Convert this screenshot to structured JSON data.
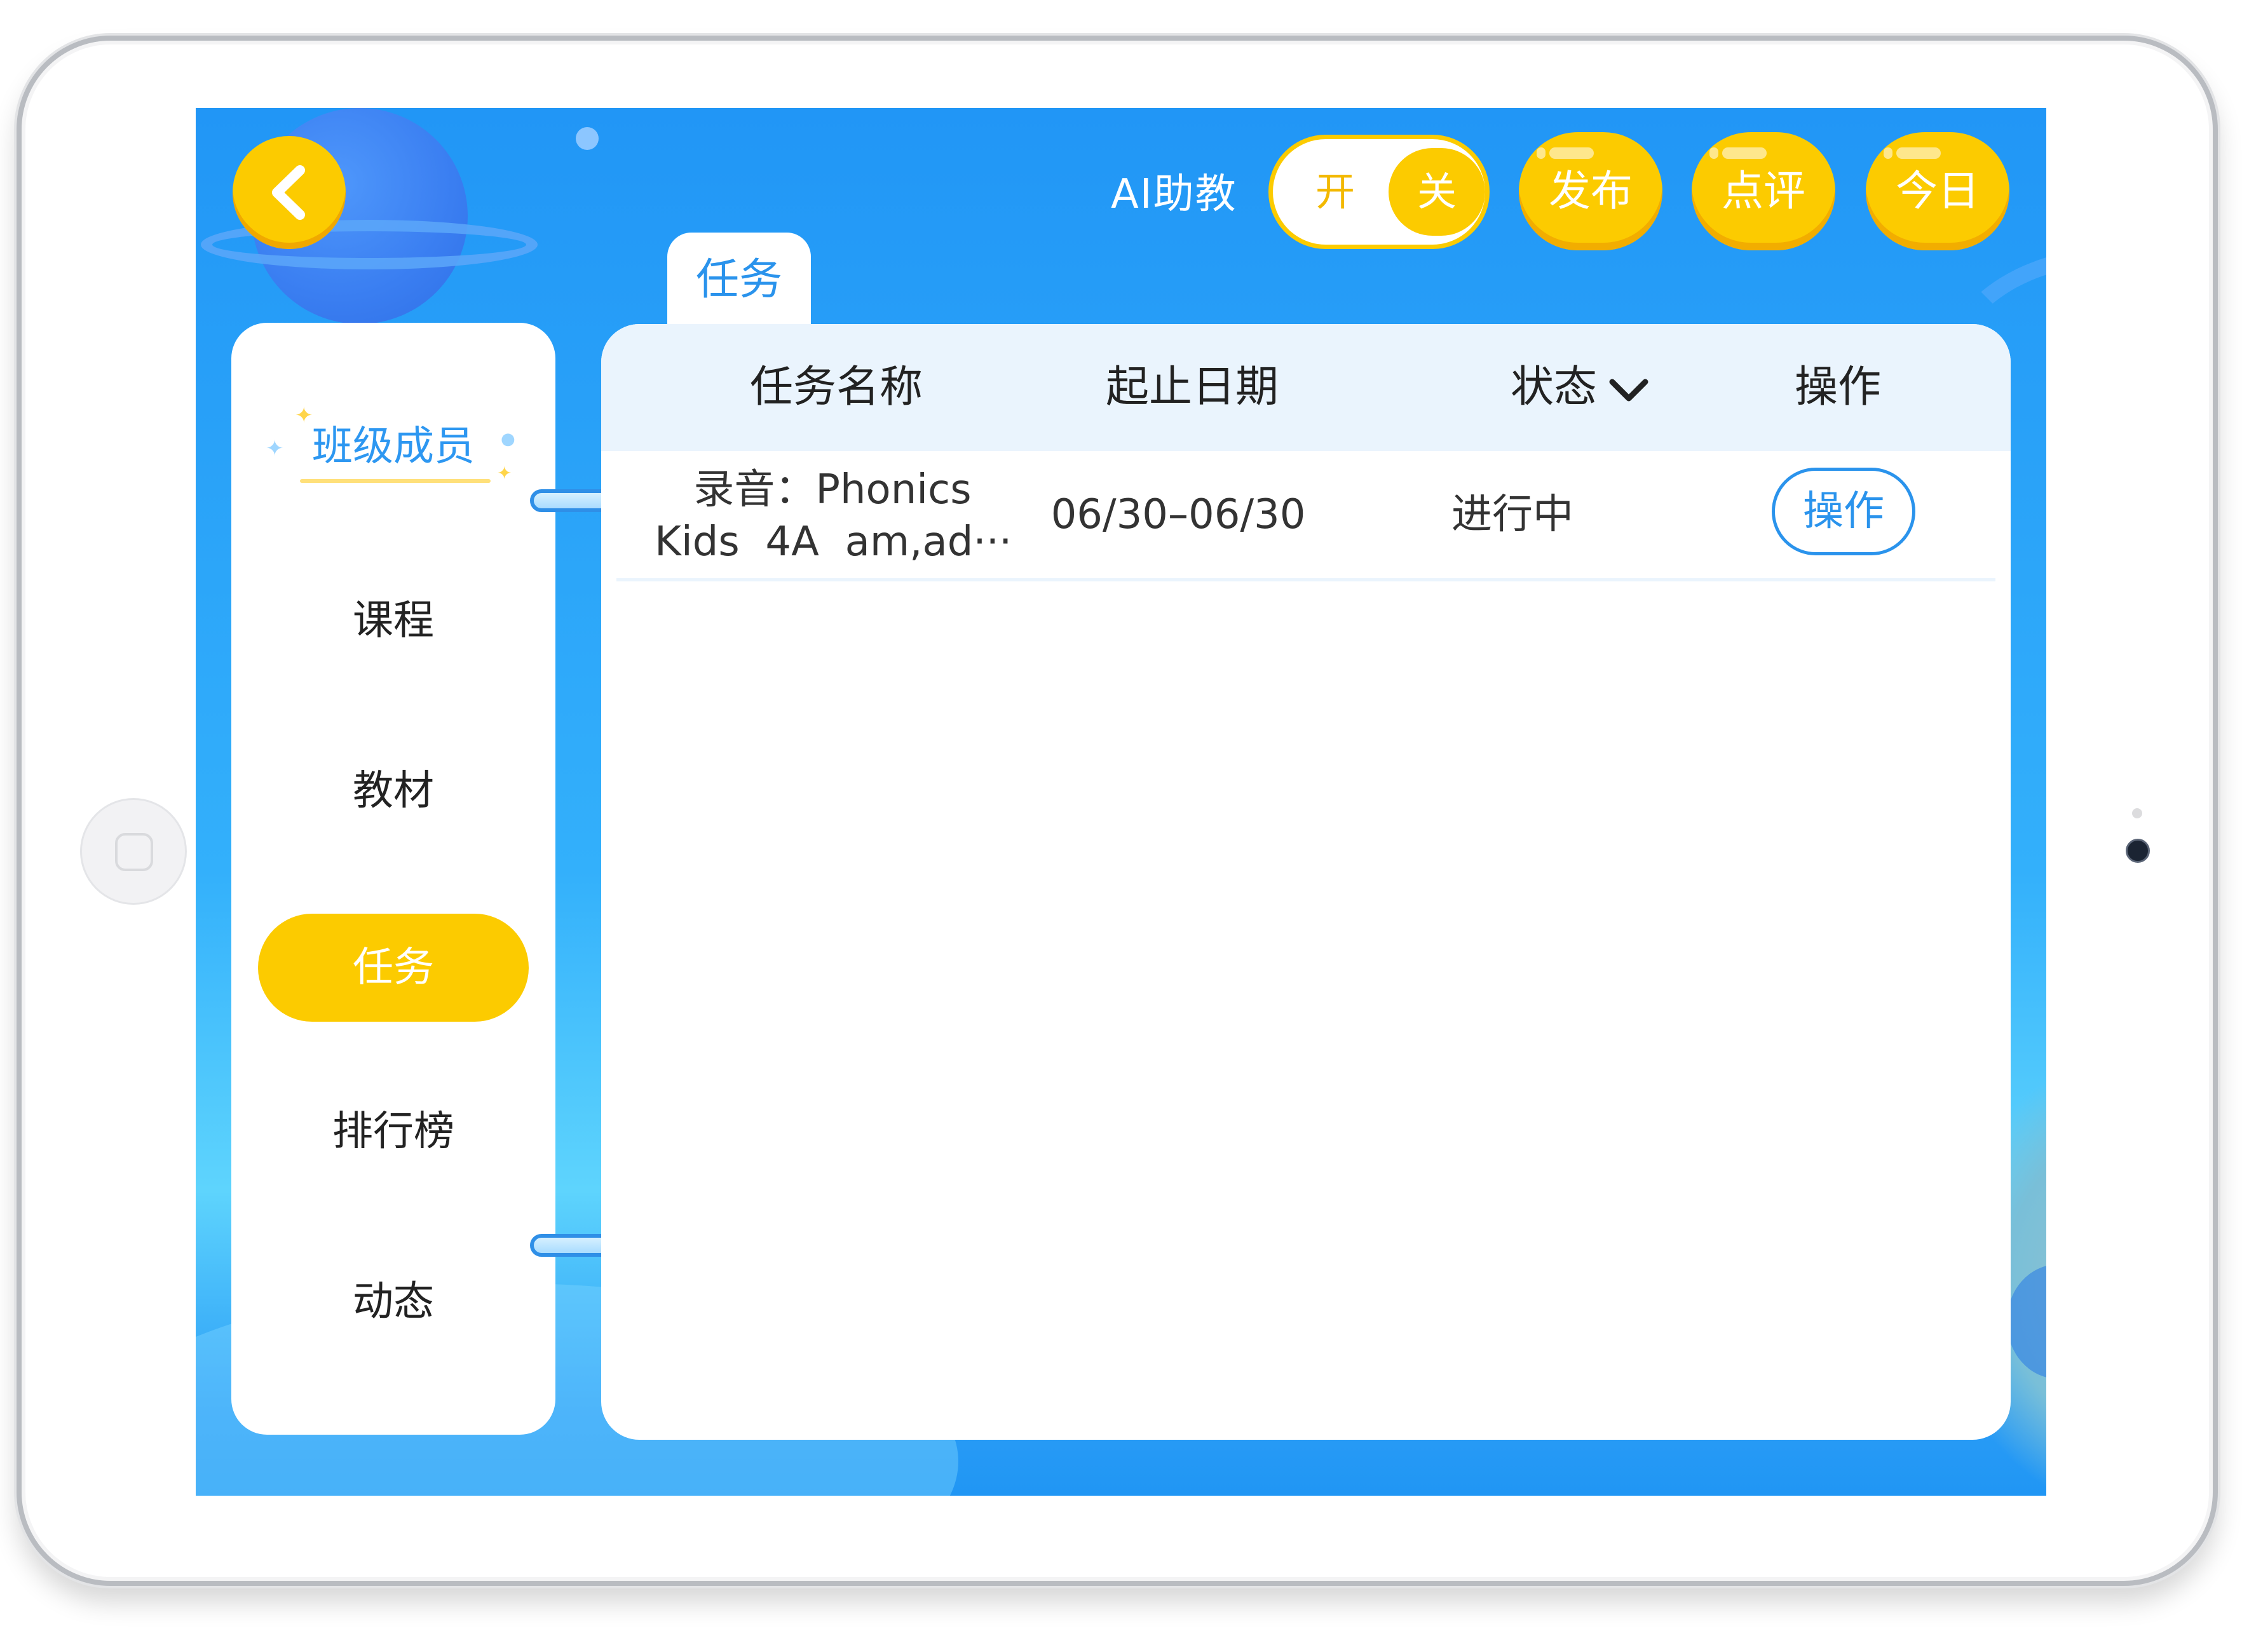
{
  "topbar": {
    "ai_label": "AI助教",
    "toggle_on": "开",
    "toggle_off": "关",
    "publish": "发布",
    "review": "点评",
    "today": "今日"
  },
  "tab": {
    "label": "任务"
  },
  "sidebar": {
    "items": [
      {
        "label": "班级成员"
      },
      {
        "label": "课程"
      },
      {
        "label": "教材"
      },
      {
        "label": "任务"
      },
      {
        "label": "排行榜"
      },
      {
        "label": "动态"
      }
    ]
  },
  "table": {
    "headers": {
      "name": "任务名称",
      "date": "起止日期",
      "status": "状态",
      "action": "操作"
    },
    "rows": [
      {
        "name_line1": "录音：Phonics",
        "name_line2": "Kids  4A  am,ad···",
        "date": "06/30–06/30",
        "status": "进行中",
        "action": "操作"
      }
    ]
  },
  "colors": {
    "accent_yellow": "#fccb00",
    "primary_blue": "#2196f6",
    "link_blue": "#2a93ec"
  },
  "icons": {
    "back": "chevron-left-icon",
    "status_dropdown": "chevron-down-icon"
  }
}
